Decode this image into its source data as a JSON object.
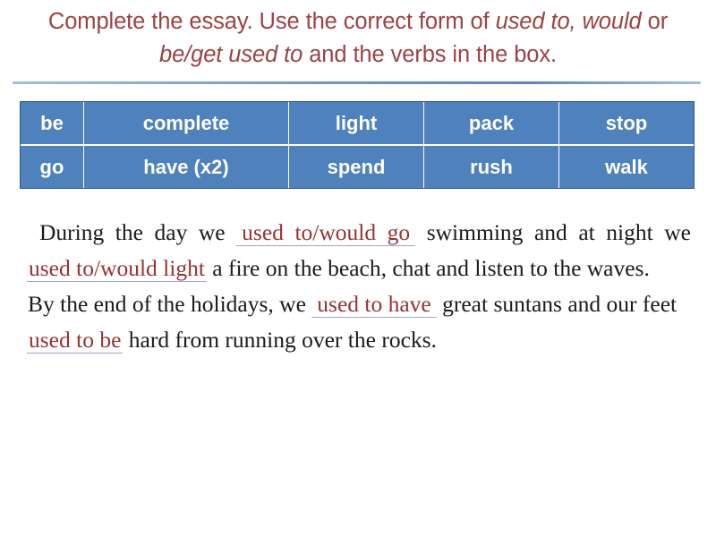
{
  "slide": {
    "title": {
      "part1": "Complete the essay. Use the correct form of ",
      "em1": "used to, would",
      "part2": " or ",
      "em2": "be/get used to",
      "part3": " and the verbs in the box."
    }
  },
  "verb_box": {
    "rows": [
      [
        "be",
        "complete",
        "light",
        "pack",
        "stop"
      ],
      [
        "go",
        "have (x2)",
        "spend",
        "rush",
        "walk"
      ]
    ]
  },
  "essay": {
    "paragraph_1": {
      "seg_1": "During the day we ",
      "answer_1": "used to/would go",
      "seg_2": " swimming and at night we ",
      "answer_2": "used to/would light",
      "seg_3": " a fire on the beach, chat and listen to the waves."
    },
    "paragraph_2": {
      "seg_1": "By the end of the holidays, we ",
      "answer_1": "used to have",
      "seg_2": " great suntans and our feet ",
      "answer_2": "used to be",
      "seg_3": " hard from running over the rocks."
    }
  },
  "colors": {
    "title_red": "#9C4242",
    "answer_red": "#973232",
    "table_blue": "#4F81BD",
    "table_border": "#2F5A8B",
    "rule_blue": "#6F96C8",
    "underline_gray": "#9BA9BE"
  }
}
